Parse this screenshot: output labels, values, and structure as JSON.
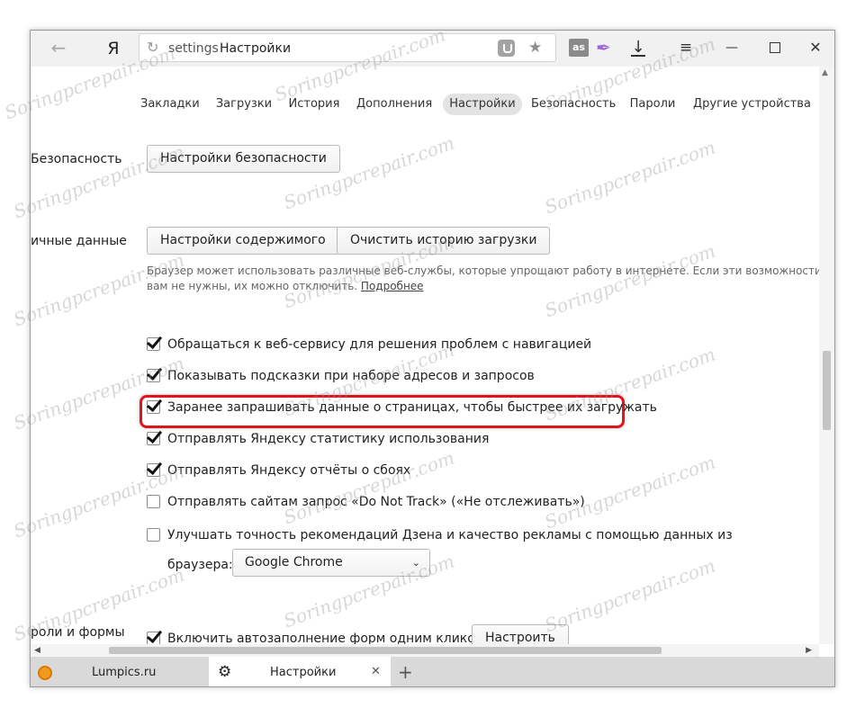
{
  "toolbar": {
    "back_glyph": "←",
    "logo": "Я",
    "reload_glyph": "↻",
    "scheme": "settings",
    "page_name": "Настройки",
    "star_glyph": "★",
    "lastfm_label": "as",
    "feather_glyph": "✒",
    "download_glyph": "↓",
    "menu_glyph": "≡",
    "minimize_glyph": "—",
    "close_glyph": "✕"
  },
  "nav": {
    "tabs": [
      {
        "label": "Закладки"
      },
      {
        "label": "Загрузки"
      },
      {
        "label": "История"
      },
      {
        "label": "Дополнения"
      },
      {
        "label": "Настройки"
      },
      {
        "label": "Безопасность"
      },
      {
        "label": "Пароли"
      },
      {
        "label": "Другие устройства"
      }
    ],
    "active_index": 4
  },
  "security": {
    "section_label": "Безопасность",
    "button": "Настройки безопасности"
  },
  "personal": {
    "section_label": "ичные данные",
    "content_button": "Настройки содержимого",
    "clear_button": "Очистить историю загрузки",
    "help_text": "Браузер может использовать различные веб-службы, которые упрощают работу в интернете. Если эти возможности вам не нужны, их можно отключить.",
    "help_link": "Подробнее",
    "options": [
      {
        "label": "Обращаться к веб-сервису для решения проблем с навигацией",
        "checked": true
      },
      {
        "label": "Показывать подсказки при наборе адресов и запросов",
        "checked": true
      },
      {
        "label": "Заранее запрашивать данные о страницах, чтобы быстрее их загружать",
        "checked": true
      },
      {
        "label": "Отправлять Яндексу статистику использования",
        "checked": true
      },
      {
        "label": "Отправлять Яндексу отчёты о сбоях",
        "checked": true
      },
      {
        "label": "Отправлять сайтам запрос «Do Not Track» («Не отслеживать»)",
        "checked": false
      }
    ],
    "zen_option_line1": "Улучшать точность рекомендаций Дзена и качество рекламы с помощью данных из",
    "zen_option_line2": "браузера:",
    "zen_checked": false,
    "browser_select_value": "Google Chrome",
    "select_chevron": "⌄"
  },
  "passwords": {
    "section_label": "роли и формы",
    "autofill_label": "Включить автозаполнение форм одним кликом",
    "autofill_checked": true,
    "configure_button": "Настроить"
  },
  "scroll": {
    "up_glyph": "▲",
    "left_glyph": "◀",
    "right_glyph": "▶"
  },
  "tabs": {
    "inactive_title": "Lumpics.ru",
    "active_title": "Настройки",
    "gear_glyph": "⚙",
    "close_glyph": "✕",
    "new_tab_glyph": "+"
  },
  "colors": {
    "highlight": "#e0141c",
    "active_tab_bg": "#e3e3e3"
  }
}
